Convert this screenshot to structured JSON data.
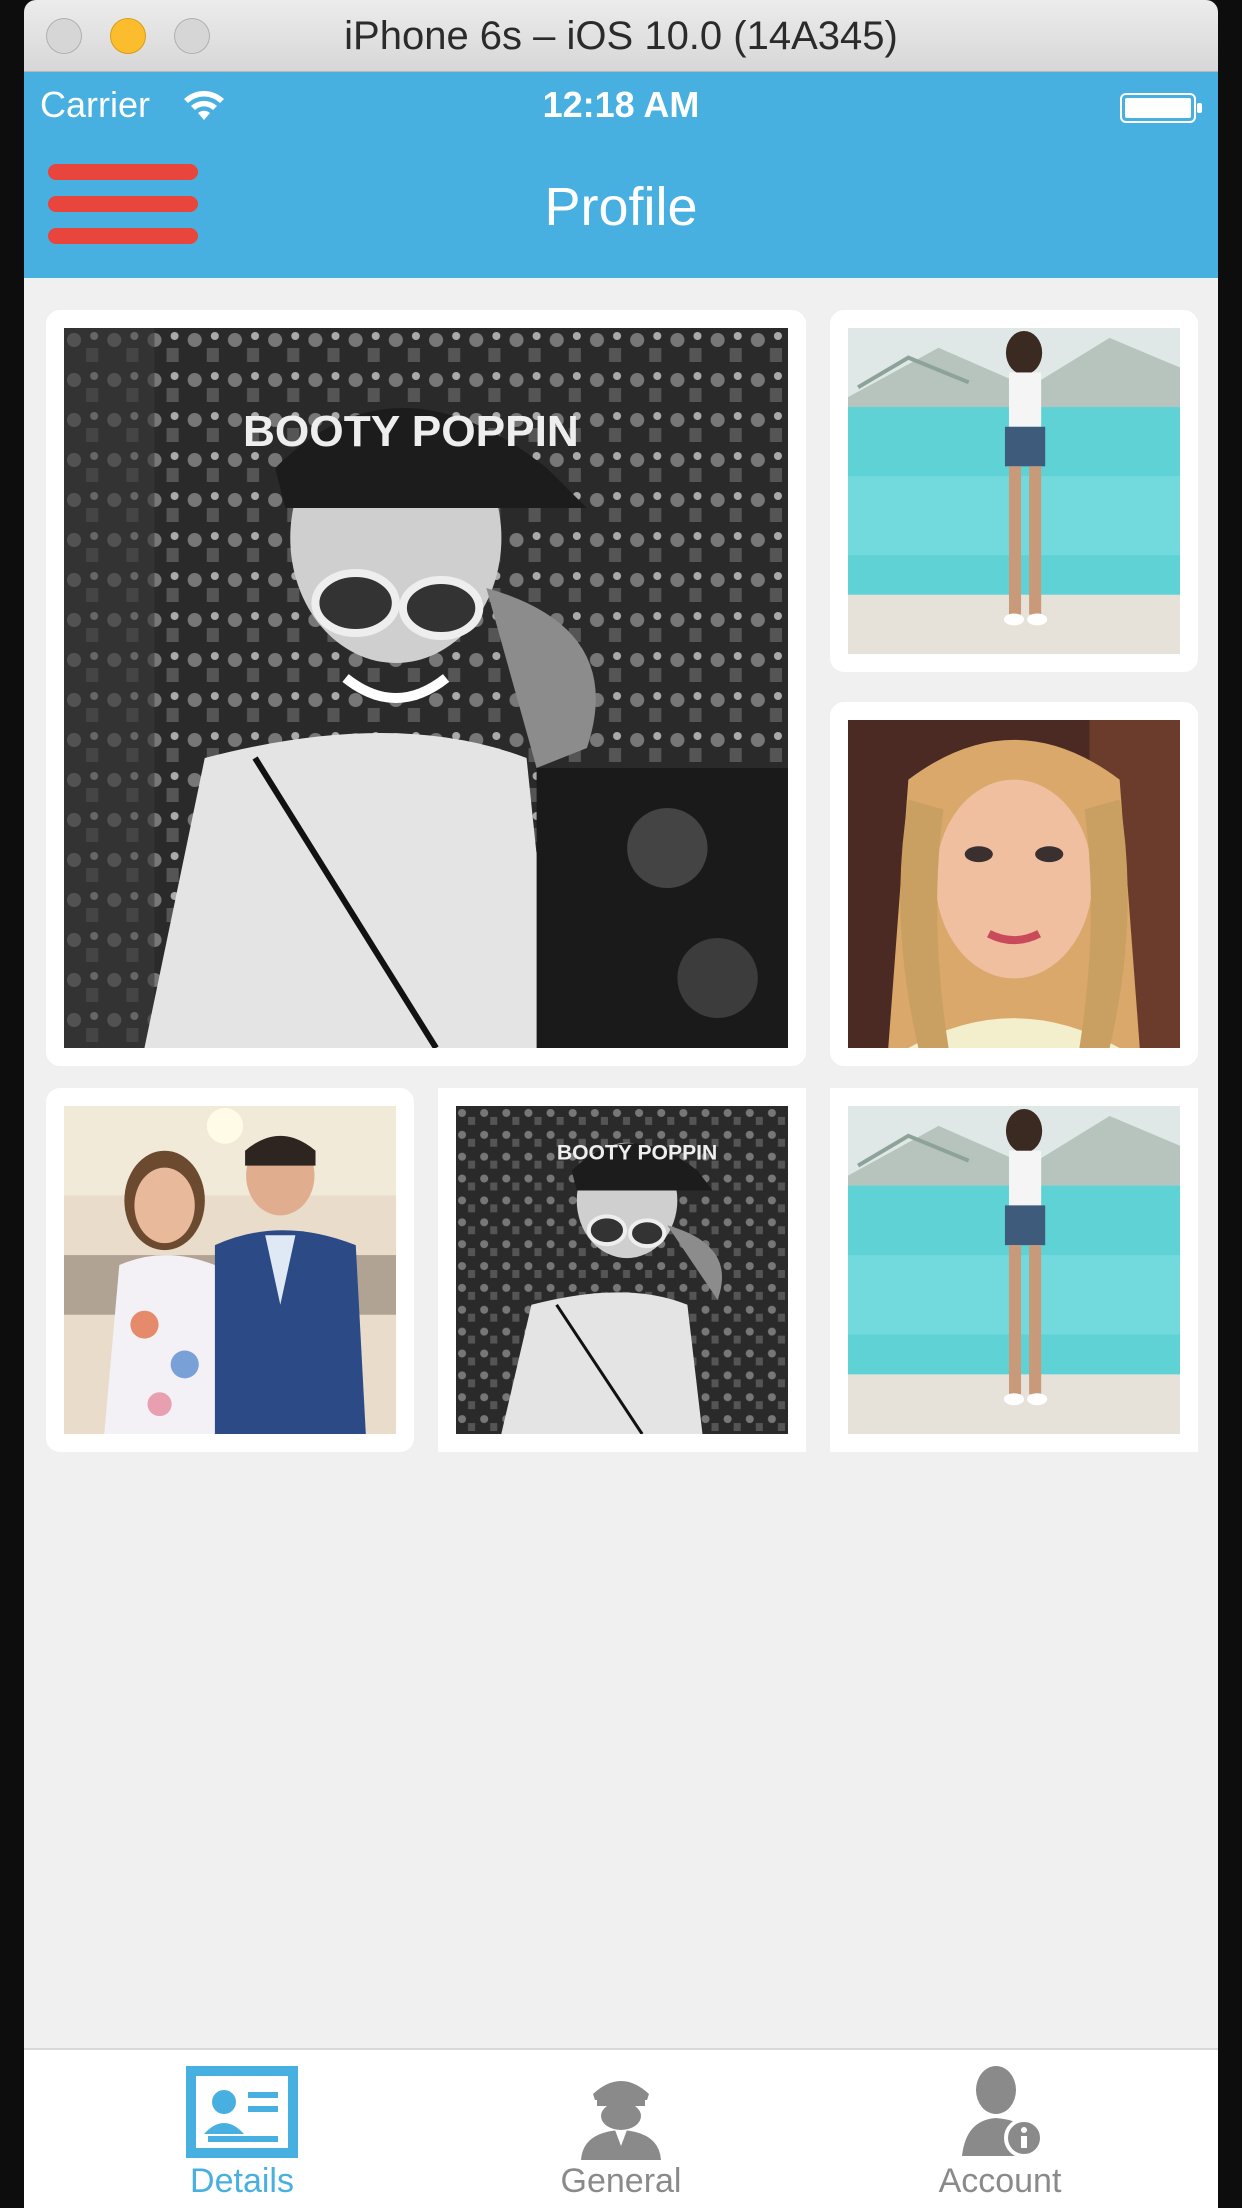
{
  "window": {
    "title": "iPhone 6s – iOS 10.0 (14A345)"
  },
  "status_bar": {
    "carrier": "Carrier",
    "time": "12:18 AM",
    "icons": [
      "wifi-icon",
      "battery-icon"
    ]
  },
  "nav": {
    "title": "Profile",
    "menu_icon": "hamburger-menu-icon",
    "accent_color": "#47b0e0",
    "menu_color": "#e8453c"
  },
  "photos": [
    {
      "description_icon": "photo",
      "style": "grayscale",
      "subject": "woman in cap and sunglasses",
      "cap_text": "BOOTY POPPIN"
    },
    {
      "description_icon": "photo",
      "style": "color",
      "subject": "woman standing by pool"
    },
    {
      "description_icon": "photo",
      "style": "color",
      "subject": "blonde woman selfie"
    },
    {
      "description_icon": "photo",
      "style": "color",
      "subject": "couple at event"
    },
    {
      "description_icon": "photo",
      "style": "grayscale",
      "subject": "woman in cap and sunglasses",
      "cap_text": "BOOTY POPPIN"
    },
    {
      "description_icon": "photo",
      "style": "color",
      "subject": "woman standing by pool"
    }
  ],
  "tabs": [
    {
      "label": "Details",
      "icon": "contact-card-icon",
      "active": true
    },
    {
      "label": "General",
      "icon": "officer-icon",
      "active": false
    },
    {
      "label": "Account",
      "icon": "user-info-icon",
      "active": false
    }
  ]
}
